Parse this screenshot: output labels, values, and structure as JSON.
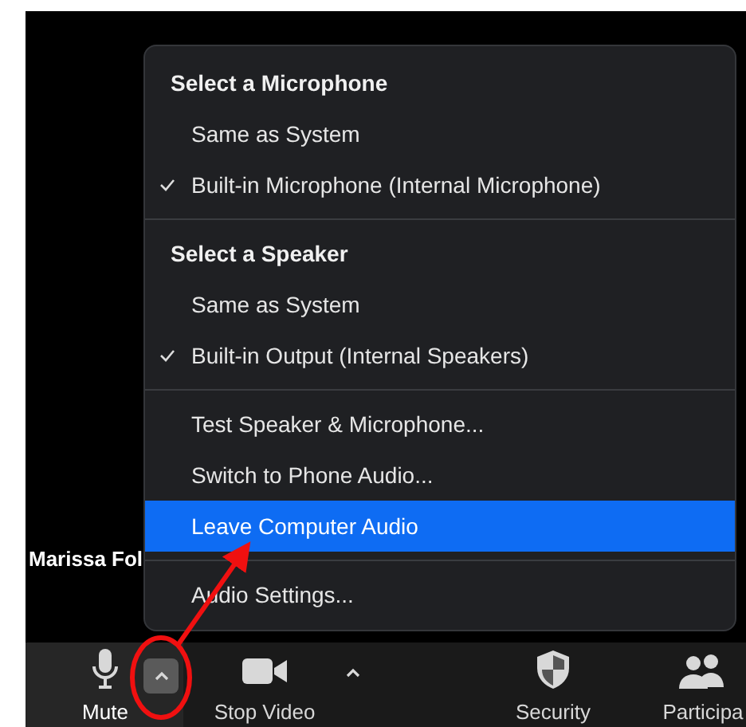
{
  "video": {
    "participant_name": "Marissa Fol"
  },
  "audio_menu": {
    "sections": [
      {
        "heading": "Select a Microphone",
        "items": [
          {
            "label": "Same as System",
            "checked": false,
            "selected": false
          },
          {
            "label": "Built-in Microphone (Internal Microphone)",
            "checked": true,
            "selected": false
          }
        ]
      },
      {
        "heading": "Select a Speaker",
        "items": [
          {
            "label": "Same as System",
            "checked": false,
            "selected": false
          },
          {
            "label": "Built-in Output (Internal Speakers)",
            "checked": true,
            "selected": false
          }
        ]
      },
      {
        "items": [
          {
            "label": "Test Speaker & Microphone...",
            "checked": false,
            "selected": false
          },
          {
            "label": "Switch to Phone Audio...",
            "checked": false,
            "selected": false
          },
          {
            "label": "Leave Computer Audio",
            "checked": false,
            "selected": true
          }
        ]
      },
      {
        "items": [
          {
            "label": "Audio Settings...",
            "checked": false,
            "selected": false
          }
        ]
      }
    ]
  },
  "toolbar": {
    "buttons": [
      {
        "kind": "mic",
        "label": "Mute",
        "has_caret": true,
        "caret_active": true
      },
      {
        "kind": "video",
        "label": "Stop Video",
        "has_caret": true,
        "caret_active": false
      },
      {
        "kind": "shield",
        "label": "Security",
        "has_caret": false,
        "caret_active": false
      },
      {
        "kind": "people",
        "label": "Participa",
        "has_caret": false,
        "caret_active": false
      }
    ]
  }
}
